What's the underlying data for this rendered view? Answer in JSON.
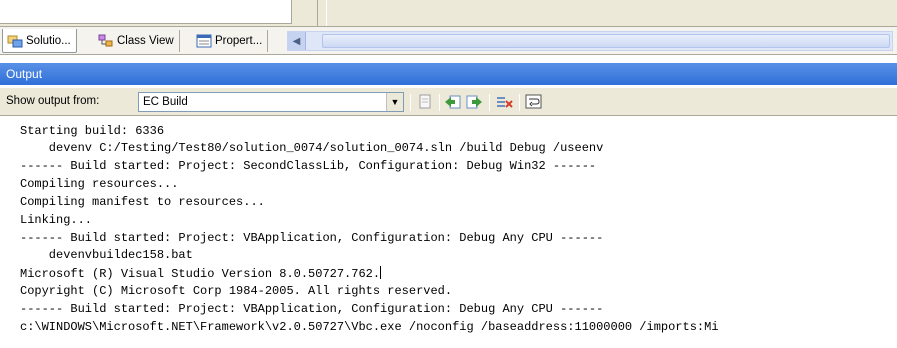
{
  "tabs": [
    {
      "label": "Solutio...",
      "icon": "solution-explorer-icon",
      "active": true
    },
    {
      "label": "Class View",
      "icon": "class-view-icon",
      "active": false
    },
    {
      "label": "Propert...",
      "icon": "properties-icon",
      "active": false
    }
  ],
  "output_pane": {
    "title": "Output",
    "show_output_label": "Show output from:",
    "show_output_value": "EC Build"
  },
  "toolbar_icons": [
    "find-icon",
    "go-to-prev-message-icon",
    "go-to-next-message-icon",
    "clear-all-icon",
    "toggle-word-wrap-icon"
  ],
  "output_lines": [
    "Starting build: 6336",
    "    devenv C:/Testing/Test80/solution_0074/solution_0074.sln /build Debug /useenv",
    "------ Build started: Project: SecondClassLib, Configuration: Debug Win32 ------",
    "Compiling resources...",
    "Compiling manifest to resources...",
    "Linking...",
    "------ Build started: Project: VBApplication, Configuration: Debug Any CPU ------",
    "    devenvbuildec158.bat",
    "Microsoft (R) Visual Studio Version 8.0.50727.762.",
    "Copyright (C) Microsoft Corp 1984-2005. All rights reserved.",
    "------ Build started: Project: VBApplication, Configuration: Debug Any CPU ------",
    "c:\\WINDOWS\\Microsoft.NET\\Framework\\v2.0.50727\\Vbc.exe /noconfig /baseaddress:11000000 /imports:Mi"
  ],
  "colors": {
    "title_bar": "#3a7be0",
    "chrome": "#ece9d8"
  }
}
